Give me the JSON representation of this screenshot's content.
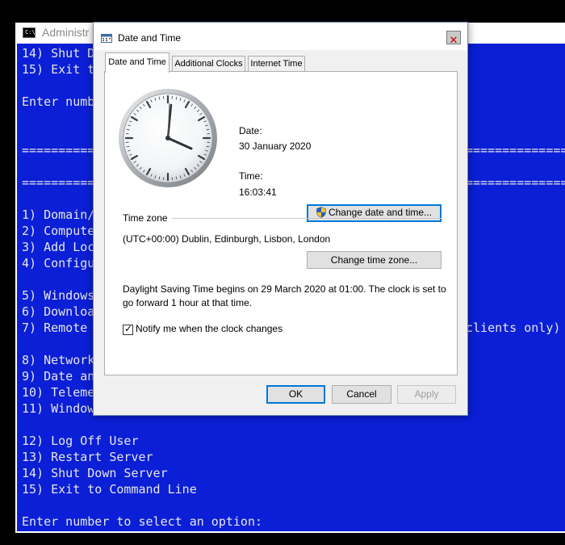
{
  "console": {
    "title": "Administr",
    "icon_text": "C:\\.",
    "visible_lines": [
      {
        "text": "14) Shut D"
      },
      {
        "text": "15) Exit t"
      },
      {
        "text": ""
      },
      {
        "text": "Enter numb"
      },
      {
        "text": ""
      },
      {
        "text": ""
      },
      {
        "text": "=========="
      },
      {
        "text": ""
      },
      {
        "text": "=========="
      },
      {
        "text": ""
      },
      {
        "text": "1) Domain/"
      },
      {
        "text": "2) Compute"
      },
      {
        "text": "3) Add Loc"
      },
      {
        "text": "4) Configu"
      },
      {
        "text": ""
      },
      {
        "text": "5) Windows"
      },
      {
        "text": "6) Downloa"
      },
      {
        "text": "7) Remote "
      },
      {
        "text": ""
      },
      {
        "text": "8) Network"
      },
      {
        "text": "9) Date an"
      },
      {
        "text": "10) Teleme"
      },
      {
        "text": "11) Window"
      },
      {
        "text": ""
      },
      {
        "text": "12) Log Off User"
      },
      {
        "text": "13) Restart Server"
      },
      {
        "text": "14) Shut Down Server"
      },
      {
        "text": "15) Exit to Command Line"
      },
      {
        "text": ""
      },
      {
        "text": "Enter number to select an option:"
      }
    ],
    "right_fragments": {
      "sep1": "=====================",
      "sep2": "=====================",
      "remote_suffix": "clients only)"
    }
  },
  "dialog": {
    "title": "Date and Time",
    "close_glyph": "✕",
    "tabs": [
      "Date and Time",
      "Additional Clocks",
      "Internet Time"
    ],
    "date_label": "Date:",
    "date_value": "30 January 2020",
    "time_label": "Time:",
    "time_value": "16:03:41",
    "change_datetime_button": "Change date and time...",
    "timezone_header": "Time zone",
    "timezone_value": "(UTC+00:00) Dublin, Edinburgh, Lisbon, London",
    "change_timezone_button": "Change time zone...",
    "dst_line1": "Daylight Saving Time begins on 29 March 2020 at 01:00. The clock is set to",
    "dst_line2": "go forward 1 hour at that time.",
    "notify_label": "Notify me when the clock changes",
    "notify_checked": true,
    "ok_button": "OK",
    "cancel_button": "Cancel",
    "apply_button": "Apply",
    "icons": {
      "dialog": "calendar-clock-icon",
      "shield": "uac-shield-icon"
    }
  },
  "colors": {
    "console_bg": "#0b1fd6",
    "console_text": "#e6e6e6",
    "focus_border": "#0078d7"
  }
}
